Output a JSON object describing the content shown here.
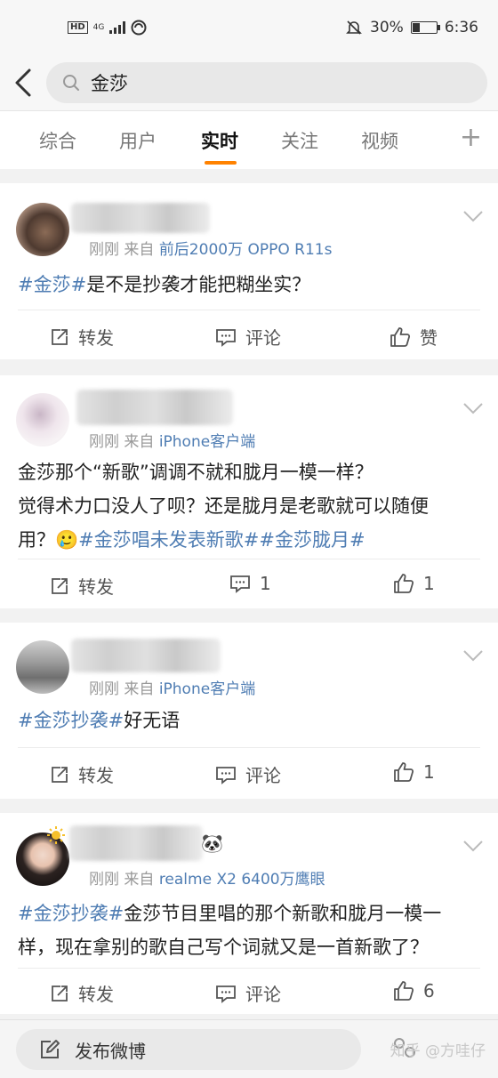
{
  "status_bar": {
    "hd": "HD",
    "network": "4G",
    "battery_text": "30%",
    "battery_level": 0.3,
    "time": "6:36"
  },
  "search": {
    "query": "金莎"
  },
  "tabs": [
    {
      "label": "综合"
    },
    {
      "label": "用户"
    },
    {
      "label": "实时"
    },
    {
      "label": "关注"
    },
    {
      "label": "视频"
    }
  ],
  "tabs_add": "+",
  "posts": [
    {
      "time": "刚刚",
      "from_label": "来自",
      "source": "前后2000万 OPPO R11s",
      "segments": [
        {
          "text": "#金莎#",
          "topic": true
        },
        {
          "text": "是不是抄袭才能把糊坐实？",
          "topic": false
        }
      ],
      "repost": "转发",
      "comment": "评论",
      "like": "赞"
    },
    {
      "time": "刚刚",
      "from_label": "来自",
      "source": "iPhone客户端",
      "line1": "金莎那个“新歌”调调不就和胧月一模一样？",
      "line2": "觉得术力口没人了呗？还是胧月是老歌就可以随便",
      "line3_plain": "用？",
      "emoji": "🥲",
      "line3_topics": "#金莎唱未发表新歌##金莎胧月#",
      "repost": "转发",
      "comment": "1",
      "like": "1"
    },
    {
      "time": "刚刚",
      "from_label": "来自",
      "source": "iPhone客户端",
      "segments": [
        {
          "text": "#金莎抄袭#",
          "topic": true
        },
        {
          "text": "好无语",
          "topic": false
        }
      ],
      "repost": "转发",
      "comment": "评论",
      "like": "1"
    },
    {
      "time": "刚刚",
      "from_label": "来自",
      "source": "realme X2 6400万鹰眼",
      "line1_topic": "#金莎抄袭#",
      "line1_text": "金莎节目里唱的那个新歌和胧月一模一",
      "line2": "样，现在拿别的歌自己写个词就又是一首新歌了？",
      "name_emoji": "🐼",
      "repost": "转发",
      "comment": "评论",
      "like": "6"
    }
  ],
  "compose": {
    "label": "发布微博"
  },
  "watermark": "知乎 @方哇仔"
}
